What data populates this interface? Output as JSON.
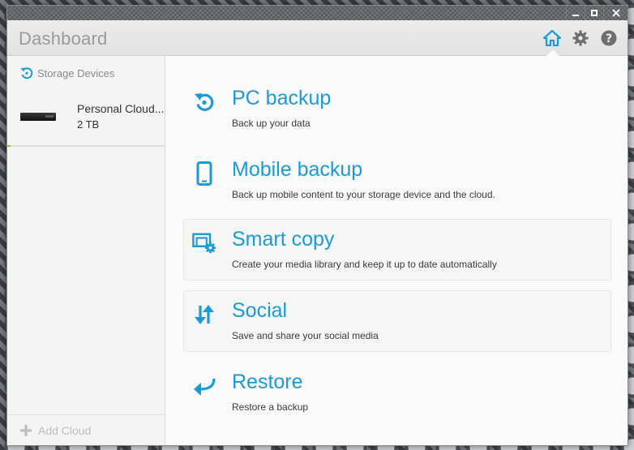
{
  "window": {
    "title": "Dashboard"
  },
  "sidebar": {
    "storage_header": "Storage Devices",
    "device": {
      "name": "Personal Cloud...",
      "capacity": "2 TB"
    },
    "add_cloud": "Add Cloud"
  },
  "actions": [
    {
      "title": "PC backup",
      "description": "Back up your data",
      "icon": "pc-backup-icon"
    },
    {
      "title": "Mobile backup",
      "description": "Back up mobile content to your storage device and the cloud.",
      "icon": "mobile-icon"
    },
    {
      "title": "Smart copy",
      "description": "Create your media library and keep it up to date automatically",
      "icon": "smart-copy-icon"
    },
    {
      "title": "Social",
      "description": "Save and share your social media",
      "icon": "social-icon"
    },
    {
      "title": "Restore",
      "description": "Restore a backup",
      "icon": "restore-icon"
    }
  ],
  "colors": {
    "accent": "#1a9ad6",
    "title_gray": "#9a9a9a",
    "icon_gray": "#6e6e6e"
  }
}
